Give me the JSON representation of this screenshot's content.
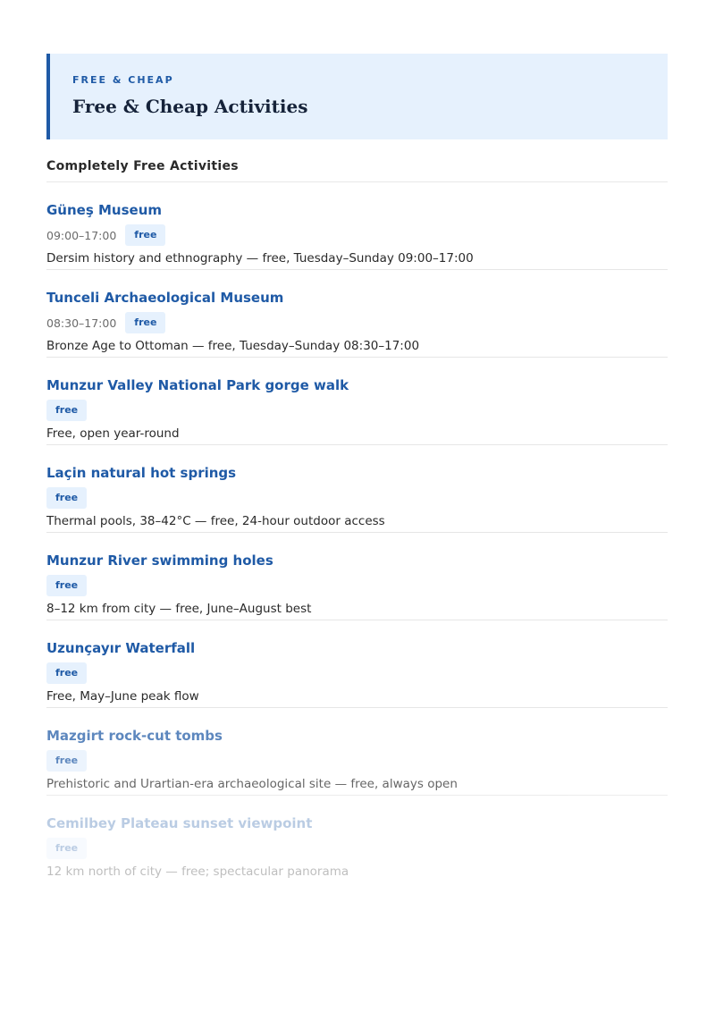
{
  "banner": {
    "eyebrow": "FREE & CHEAP",
    "title": "Free & Cheap Activities"
  },
  "section": {
    "heading": "Completely Free Activities"
  },
  "items": [
    {
      "title": "Güneş Museum",
      "hours": "09:00–17:00",
      "badge": "free",
      "desc": "Dersim history and ethnography — free, Tuesday–Sunday 09:00–17:00"
    },
    {
      "title": "Tunceli Archaeological Museum",
      "hours": "08:30–17:00",
      "badge": "free",
      "desc": "Bronze Age to Ottoman — free, Tuesday–Sunday 08:30–17:00"
    },
    {
      "title": "Munzur Valley National Park gorge walk",
      "badge": "free",
      "desc": "Free, open year-round"
    },
    {
      "title": "Laçin natural hot springs",
      "badge": "free",
      "desc": "Thermal pools, 38–42°C — free, 24-hour outdoor access"
    },
    {
      "title": "Munzur River swimming holes",
      "badge": "free",
      "desc": "8–12 km from city — free, June–August best"
    },
    {
      "title": "Uzunçayır Waterfall",
      "badge": "free",
      "desc": "Free, May–June peak flow"
    },
    {
      "title": "Mazgirt rock-cut tombs",
      "badge": "free",
      "desc": "Prehistoric and Urartian-era archaeological site — free, always open"
    },
    {
      "title": "Cemilbey Plateau sunset viewpoint",
      "badge": "free",
      "desc": "12 km north of city — free; spectacular panorama"
    }
  ]
}
